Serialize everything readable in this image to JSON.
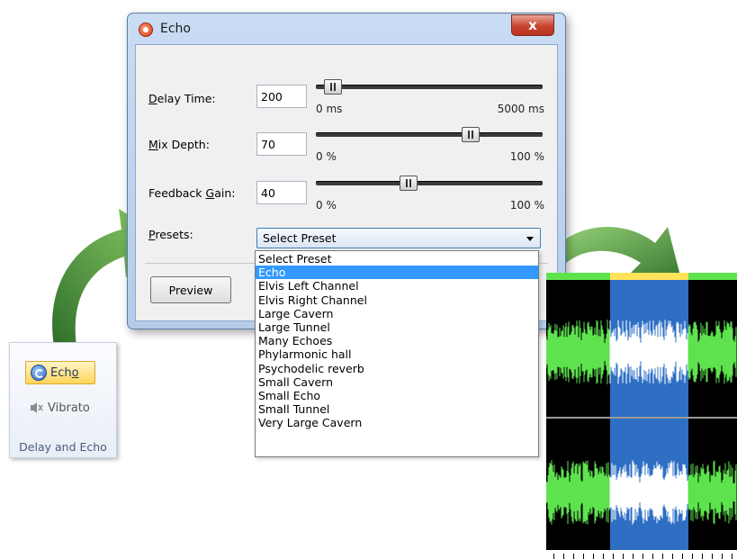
{
  "dialog": {
    "title": "Echo",
    "close_glyph": "x",
    "rows": [
      {
        "label_underline": "D",
        "label_rest": "elay Time:",
        "value": "200",
        "min_label": "0 ms",
        "max_label": "5000 ms",
        "level_percent": 4
      },
      {
        "label_underline": "M",
        "label_rest": "ix Depth:",
        "value": "70",
        "min_label": "0 %",
        "max_label": "100 %",
        "level_percent": 70
      },
      {
        "label_pre": "Feedback ",
        "label_underline": "G",
        "label_rest": "ain:",
        "value": "40",
        "min_label": "0 %",
        "max_label": "100 %",
        "level_percent": 40
      }
    ],
    "presets_label_underline": "P",
    "presets_label_rest": "resets:",
    "presets_selected": "Select Preset",
    "preview_label": "Preview"
  },
  "preset_options": [
    "Select Preset",
    "Echo",
    "Elvis Left Channel",
    "Elvis Right Channel",
    "Large Cavern",
    "Large Tunnel",
    "Many Echoes",
    "Phylarmonic hall",
    "Psychodelic reverb",
    "Small Cavern",
    "Small Echo",
    "Small Tunnel",
    "Very Large Cavern"
  ],
  "highlighted_option": "Echo",
  "ribbon": {
    "echo_prefix": "Ech",
    "echo_underline": "o",
    "vibrato_label": "Vibrato",
    "group_caption": "Delay and Echo"
  },
  "colors": {
    "wave_green": "#5ee34f",
    "wave_selection": "#2e6fc4",
    "list_highlight": "#3399ff"
  },
  "icons": {
    "dialog": "echo-effect-icon",
    "ribbon_echo": "echo-icon",
    "ribbon_vibrato": "vibrato-speaker-icon",
    "close": "close-icon",
    "dropdown": "chevron-down-icon"
  }
}
